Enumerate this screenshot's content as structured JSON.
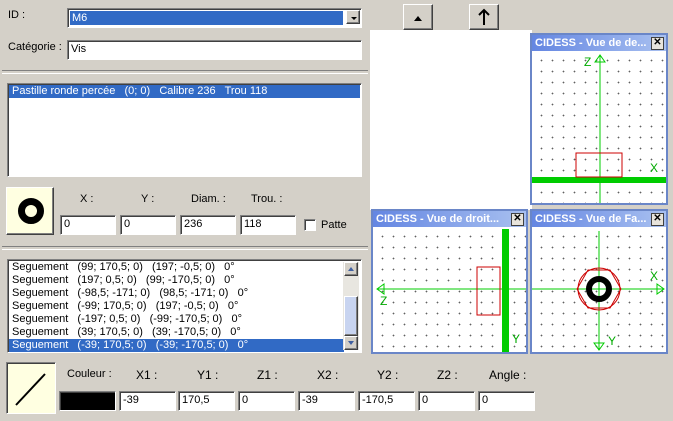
{
  "form": {
    "id_label": "ID :",
    "id_value": "M6",
    "category_label": "Catégorie :",
    "category_value": "Vis"
  },
  "pastille_list": {
    "items": [
      "Pastille ronde percée   (0; 0)   Calibre 236   Trou 118"
    ]
  },
  "pastille_fields": {
    "x_label": "X :",
    "y_label": "Y :",
    "diam_label": "Diam. :",
    "trou_label": "Trou. :",
    "x": "0",
    "y": "0",
    "diam": "236",
    "trou": "118",
    "patte_label": "Patte"
  },
  "segment_list": {
    "items": [
      "Seguement   (99; 170,5; 0)   (197; -0,5; 0)   0°",
      "Seguement   (197; 0,5; 0)   (99; -170,5; 0)   0°",
      "Seguement   (-98,5; -171; 0)   (98,5; -171; 0)   0°",
      "Seguement   (-99; 170,5; 0)   (197; -0,5; 0)   0°",
      "Seguement   (-197; 0,5; 0)   (-99; -170,5; 0)   0°",
      "Seguement   (39; 170,5; 0)   (39; -170,5; 0)   0°",
      "Seguement   (-39; 170,5; 0)   (-39; -170,5; 0)   0°"
    ]
  },
  "segment_fields": {
    "couleur_label": "Couleur :",
    "x1_label": "X1 :",
    "y1_label": "Y1 :",
    "z1_label": "Z1 :",
    "x2_label": "X2 :",
    "y2_label": "Y2 :",
    "z2_label": "Z2 :",
    "angle_label": "Angle :",
    "color": "#000000",
    "x1": "-39",
    "y1": "170,5",
    "z1": "0",
    "x2": "-39",
    "y2": "-170,5",
    "z2": "0",
    "angle": "0"
  },
  "windows": {
    "dessus": {
      "title": "CIDESS - Vue de de...",
      "axis_v": "Z",
      "axis_h": "X"
    },
    "droite": {
      "title": "CIDESS - Vue de droit...",
      "axis_h": "Z",
      "axis_v": "Y"
    },
    "face": {
      "title": "CIDESS - Vue de Fa...",
      "axis_h": "X",
      "axis_v": "Y"
    }
  },
  "icons": {
    "up_small": "triangle-up-icon",
    "up_arrow": "arrow-up-icon",
    "pastille_preview": "ring-icon",
    "segment_preview": "diagonal-line-icon"
  },
  "colors": {
    "axis_green": "#00cc00",
    "outline_red": "#cc0000",
    "selection_blue": "#316ac5"
  }
}
